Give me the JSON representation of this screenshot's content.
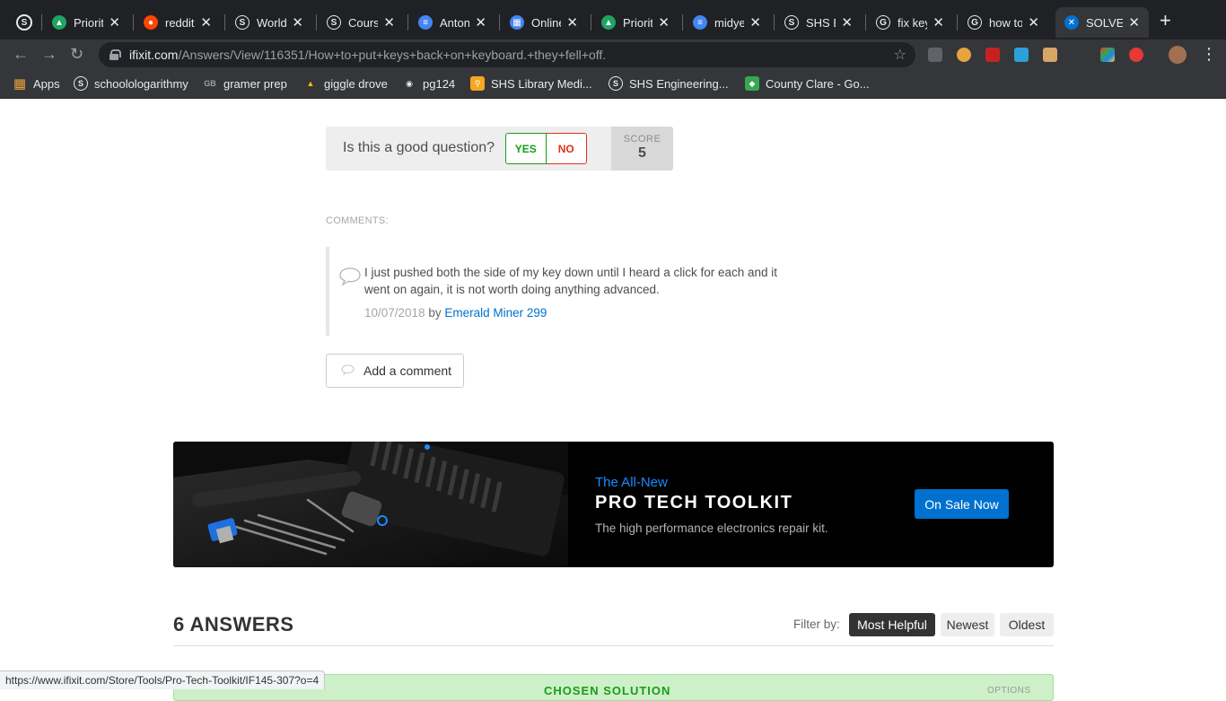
{
  "browser": {
    "tabs": [
      {
        "title": "Priority",
        "icon": "drive-icon",
        "color": "#1fa463"
      },
      {
        "title": "reddit:",
        "icon": "reddit-icon",
        "color": "#ff4500"
      },
      {
        "title": "World I",
        "icon": "schoology-icon",
        "color": "#ffffff"
      },
      {
        "title": "Course",
        "icon": "schoology-icon",
        "color": "#ffffff"
      },
      {
        "title": "Anton",
        "icon": "docs-icon",
        "color": "#4285f4"
      },
      {
        "title": "Online",
        "icon": "generic-icon",
        "color": "#4285f4"
      },
      {
        "title": "Priority",
        "icon": "drive-icon",
        "color": "#1fa463"
      },
      {
        "title": "midyea",
        "icon": "docs-icon",
        "color": "#4285f4"
      },
      {
        "title": "SHS Er",
        "icon": "schoology-icon",
        "color": "#ffffff"
      },
      {
        "title": "fix key",
        "icon": "google-icon",
        "color": "#ffffff"
      },
      {
        "title": "how to",
        "icon": "google-icon",
        "color": "#ffffff"
      },
      {
        "title": "SOLVE",
        "icon": "ifixit-icon",
        "color": "#0071ce"
      }
    ],
    "close_glyph": "✕",
    "url_domain": "ifixit.com",
    "url_path": "/Answers/View/116351/How+to+put+keys+back+on+keyboard.+they+fell+off.",
    "bookmarks": [
      {
        "label": "Apps",
        "icon": "apps-grid-icon"
      },
      {
        "label": "schoolologarithmy",
        "icon": "schoology-icon"
      },
      {
        "label": "gramer prep",
        "icon": "gb-icon"
      },
      {
        "label": "giggle drove",
        "icon": "drive-icon"
      },
      {
        "label": "pg124",
        "icon": "globe-icon"
      },
      {
        "label": "SHS Library Medi...",
        "icon": "library-icon"
      },
      {
        "label": "SHS Engineering...",
        "icon": "schoology-icon"
      },
      {
        "label": "County Clare - Go...",
        "icon": "maps-icon"
      }
    ]
  },
  "vote": {
    "question": "Is this a good question?",
    "yes": "YES",
    "no": "NO",
    "score_label": "SCORE",
    "score_value": "5"
  },
  "comments": {
    "label": "COMMENTS:",
    "items": [
      {
        "text": "I just pushed both the side of my key down until I heard a click for each and it went on again, it is not worth doing anything advanced.",
        "date": "10/07/2018",
        "by": "by",
        "author": "Emerald Miner 299"
      }
    ],
    "add_label": "Add a comment"
  },
  "banner": {
    "kicker": "The All-New",
    "title": "PRO TECH TOOLKIT",
    "subtitle": "The high performance electronics repair kit.",
    "cta": "On Sale Now"
  },
  "answers": {
    "title": "6 ANSWERS",
    "filter_label": "Filter by:",
    "filters": [
      "Most Helpful",
      "Newest",
      "Oldest"
    ],
    "solution_label": "CHOSEN SOLUTION",
    "options_label": "OPTIONS"
  },
  "status_bar_url": "https://www.ifixit.com/Store/Tools/Pro-Tech-Toolkit/IF145-307?o=4",
  "colors": {
    "link": "#0071ce",
    "yes": "#1a9c1a",
    "no": "#e0301e",
    "banner_kicker": "#1a8cff"
  }
}
